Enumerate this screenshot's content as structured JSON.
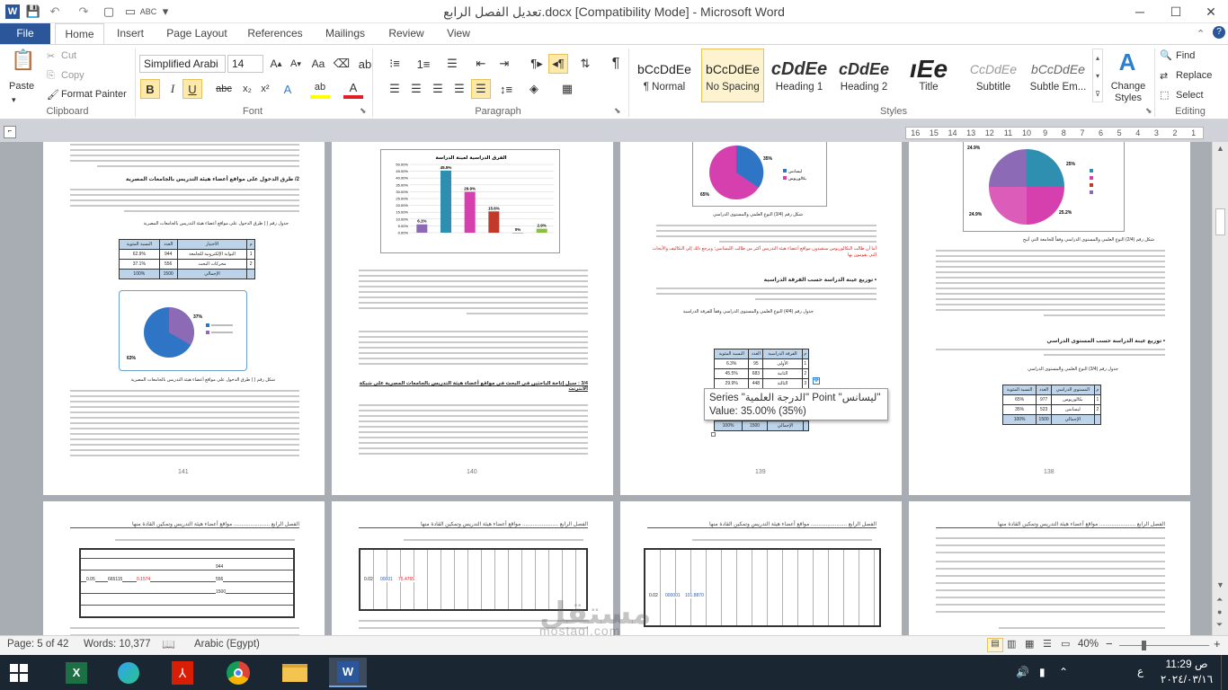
{
  "window": {
    "title": "تعديل الفصل الرابع.docx [Compatibility Mode] - Microsoft Word",
    "minimize": "─",
    "maximize": "☐",
    "close": "✕"
  },
  "tabs": [
    "File",
    "Home",
    "Insert",
    "Page Layout",
    "References",
    "Mailings",
    "Review",
    "View"
  ],
  "ribbon": {
    "clipboard": {
      "paste": "Paste",
      "cut": "Cut",
      "copy": "Copy",
      "format_painter": "Format Painter",
      "label": "Clipboard"
    },
    "font": {
      "name": "Simplified Arabi",
      "size": "14",
      "label": "Font"
    },
    "paragraph": {
      "label": "Paragraph"
    },
    "styles": {
      "label": "Styles",
      "items": [
        {
          "sample": "bCcDdEe",
          "name": "¶ Normal"
        },
        {
          "sample": "bCcDdEe",
          "name": "No Spacing"
        },
        {
          "sample": "cDdEe",
          "name": "Heading 1"
        },
        {
          "sample": "cDdEe",
          "name": "Heading 2"
        },
        {
          "sample": "ıEe",
          "name": "Title"
        },
        {
          "sample": "CcDdEe",
          "name": "Subtitle"
        },
        {
          "sample": "bCcDdEe",
          "name": "Subtle Em..."
        }
      ],
      "change_styles": "Change Styles"
    },
    "editing": {
      "find": "Find",
      "replace": "Replace",
      "select": "Select",
      "label": "Editing"
    }
  },
  "ruler": {
    "ticks": [
      "16",
      "15",
      "14",
      "13",
      "12",
      "11",
      "10",
      "9",
      "8",
      "7",
      "6",
      "5",
      "4",
      "3",
      "2",
      "1"
    ]
  },
  "pages": {
    "p141": {
      "number": "141",
      "heading": "2/ طرق الدخول على مواقع أعضاء هيئة التدريس بالجامعات المصرية",
      "table_caption": "جدول رقم (  ) طرق الدخول على مواقع أعضاء هيئة التدريس بالجامعات المصرية",
      "table": [
        [
          "م",
          "الاختيار",
          "العدد",
          "النسبة المئوية"
        ],
        [
          "1",
          "البوابة الإلكترونية للجامعة",
          "944",
          "62.9%"
        ],
        [
          "2",
          "محركات البحث",
          "556",
          "37.1%"
        ],
        [
          "",
          "الإجمالي",
          "1500",
          "100%"
        ]
      ],
      "chart_caption": "شكل رقم (  ) طرق الدخول على مواقع أعضاء هيئة التدريس بالجامعات المصرية",
      "pie": {
        "labels": [
          "37%",
          "63%"
        ]
      }
    },
    "p140": {
      "number": "140",
      "chart_title": "الفرق الدراسية لعينة الدراسة",
      "y_ticks": [
        "50.00%",
        "45.00%",
        "40.00%",
        "35.00%",
        "30.00%",
        "25.00%",
        "20.00%",
        "15.00%",
        "10.00%",
        "5.00%",
        "0.00%"
      ],
      "bar_labels": [
        "6.1%",
        "45.5%",
        "29.9%",
        "15.6%",
        "0%",
        "2.9%"
      ],
      "heading": "3/4 : سبل إتاحة الباحثين في البحث في مواقع أعضاء هيئة التدريس بالجامعات المصرية على شبكة الانترنت"
    },
    "p139": {
      "number": "139",
      "pie_labels": [
        "35%",
        "65%"
      ],
      "legend": [
        "ليسانس",
        "بكالوريوس"
      ],
      "chart_caption": "شكل رقم (3/4) النوع العلمي والمستوى الدراسي",
      "red_text": "أما أن طالب البكالوريوس ستفيدون مواقع أعضاء هيئة التدريس أكثر من طالب الليسانس؛ ويرجع ذلك إلى التكاليف والأبحاث التي يقومون بها",
      "heading": "• توزيع عينة الدراسة حسب الفرقة الدراسية",
      "table_caption": "جدول رقم (4/4) النوع العلمي والمستوى الدراسي وفقاً للفرقة الدراسية",
      "table": [
        [
          "م",
          "الفرقة الدراسية",
          "العدد",
          "النسبة المئوية"
        ],
        [
          "1",
          "الأولى",
          "95",
          "6.3%"
        ],
        [
          "2",
          "الثانية",
          "683",
          "45.5%"
        ],
        [
          "3",
          "الثالثة",
          "448",
          "29.9%"
        ],
        [
          "",
          "الإجمالي",
          "1500",
          "100%"
        ]
      ],
      "tooltip_line1": "Series \"الدرجة العلمية\" Point \"ليسانس\"",
      "tooltip_line2": "Value: 35.00% (35%)"
    },
    "p138": {
      "number": "138",
      "pie_labels": [
        "24.9%",
        "25%",
        "25.2%",
        "24.9%"
      ],
      "chart_caption": "شكل رقم (2/4) النوع العلمي والمستوى الدراسي وفقاً للجامعة التي أتيح",
      "heading": "• توزيع عينة الدراسة حسب المستوى الدراسي",
      "table_caption": "جدول رقم (3/4) النوع العلمي والمستوى الدراسي",
      "table": [
        [
          "م",
          "المستوى الدراسي",
          "العدد",
          "النسبة المئوية"
        ],
        [
          "1",
          "بكالوريوس",
          "977",
          "65%"
        ],
        [
          "2",
          "ليسانس",
          "523",
          "35%"
        ],
        [
          "",
          "الإجمالي",
          "1500",
          "100%"
        ]
      ]
    },
    "bottom": {
      "header": "الفصل الرابع ........................ مواقع أعضاء هيئة التدريس وتمكين القادة منها",
      "values_a": [
        "944",
        "556",
        "1500",
        "0.1574",
        "665115",
        "0.05"
      ],
      "values_b": [
        "75.4765",
        "00001",
        "0.02"
      ],
      "values_c": [
        "101.8870",
        "000001",
        "0.02"
      ]
    }
  },
  "status": {
    "page": "Page: 5 of 42",
    "words": "Words: 10,377",
    "language": "Arabic (Egypt)",
    "zoom": "40%"
  },
  "watermark": {
    "arabic": "مستقل",
    "latin": "mostaql.com"
  },
  "taskbar": {
    "time": "11:29 ص",
    "date": "٢٠٢٤/٠٣/١٦",
    "lang": "ع"
  }
}
